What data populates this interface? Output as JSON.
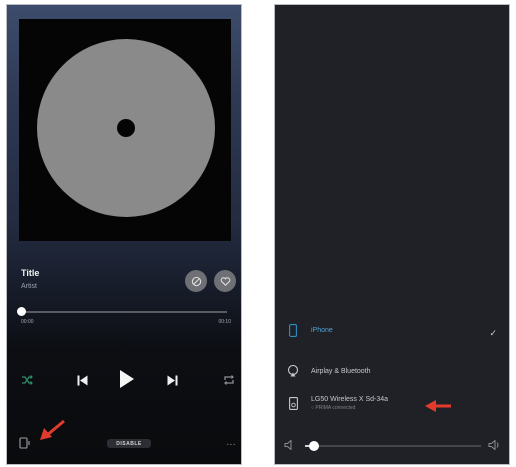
{
  "player": {
    "title": "Title",
    "artist": "Artist",
    "elapsed": "00:00",
    "duration": "00:10",
    "progress_fraction": 0.01,
    "output_label": "DISABLE",
    "more": "…",
    "icons": [
      "album-disc-icon",
      "dislike-icon",
      "like-icon",
      "shuffle-icon",
      "previous-icon",
      "play-icon",
      "next-icon",
      "repeat-icon",
      "airplay-output-icon"
    ]
  },
  "output_panel": {
    "items": [
      {
        "label": "iPhone",
        "icon": "phone-icon",
        "selected": true
      },
      {
        "label": "Airplay & Bluetooth",
        "icon": "airplay-icon",
        "selected": false
      },
      {
        "label": "LG50 Wireless X Sd-34a",
        "sublabel": "○ PRIMA connected",
        "icon": "speaker-icon",
        "selected": false
      }
    ],
    "volume_fraction": 0.05
  },
  "colors": {
    "accent_green": "#2f8f6b",
    "annotation_red": "#e23b2e"
  }
}
